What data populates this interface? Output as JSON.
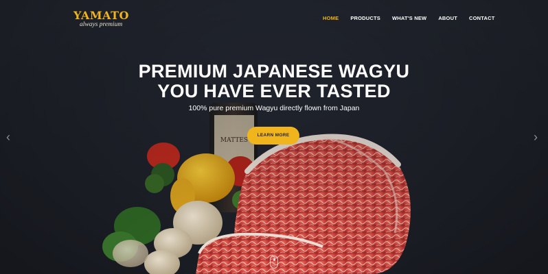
{
  "brand": {
    "name": "YAMATO",
    "tagline": "always premium"
  },
  "nav": {
    "items": [
      {
        "label": "HOME",
        "active": true
      },
      {
        "label": "PRODUCTS",
        "active": false
      },
      {
        "label": "WHAT'S NEW",
        "active": false
      },
      {
        "label": "ABOUT",
        "active": false
      },
      {
        "label": "CONTACT",
        "active": false
      }
    ]
  },
  "hero": {
    "title_line1": "PREMIUM JAPANESE WAGYU",
    "title_line2": "YOU HAVE EVER TASTED",
    "subtitle": "100% pure premium Wagyu directly flown from Japan",
    "cta_label": "LEARN MORE",
    "bottle_label": "MATTES"
  },
  "icons": {
    "prev": "chevron-left-icon",
    "next": "chevron-right-icon",
    "scroll": "mouse-scroll-icon"
  },
  "colors": {
    "accent": "#f0b51c",
    "background": "#1d2028",
    "text": "#ffffff"
  }
}
